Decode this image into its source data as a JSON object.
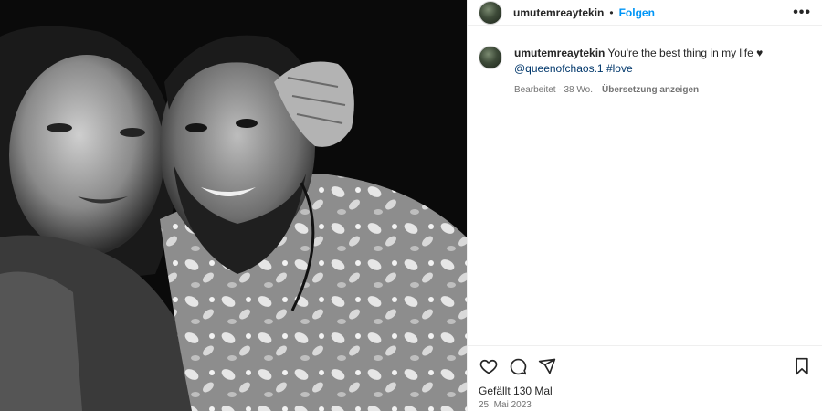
{
  "post": {
    "username": "umutemreaytekin",
    "separator": "•",
    "follow_label": "Folgen",
    "more_label": "•••"
  },
  "caption": {
    "username": "umutemreaytekin",
    "text": "You're the best thing in my life ♥",
    "mention": "@queenofchaos.1",
    "hashtag": "#love",
    "edited": "Bearbeitet · 38 Wo.",
    "translate_label": "Übersetzung anzeigen"
  },
  "footer": {
    "likes": "Gefällt 130 Mal",
    "date": "25. Mai 2023"
  },
  "icons": {
    "like": "heart-icon",
    "comment": "comment-icon",
    "share": "share-icon",
    "save": "bookmark-icon"
  },
  "colors": {
    "follow": "#0095f6",
    "link": "#00376b",
    "muted": "#737373"
  }
}
